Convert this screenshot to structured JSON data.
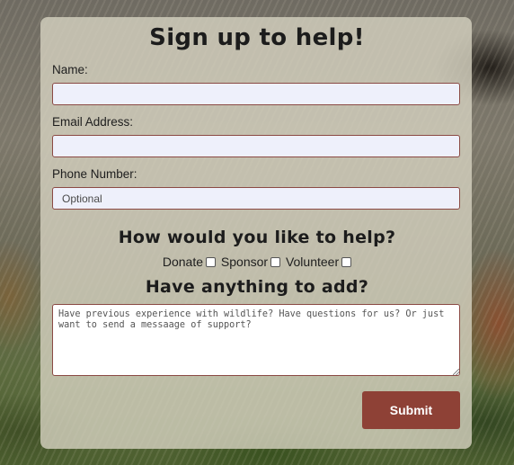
{
  "form": {
    "title": "Sign up to help!",
    "name_label": "Name:",
    "name_value": "",
    "email_label": "Email Address:",
    "email_value": "",
    "phone_label": "Phone Number:",
    "phone_value": "",
    "phone_placeholder": "Optional",
    "help_heading": "How would you like to help?",
    "options": [
      {
        "label": "Donate",
        "checked": false
      },
      {
        "label": "Sponsor",
        "checked": false
      },
      {
        "label": "Volunteer",
        "checked": false
      }
    ],
    "add_heading": "Have anything to add?",
    "message_value": "",
    "message_placeholder": "Have previous experience with wildlife? Have questions for us? Or just want to send a messaage of support?",
    "submit_label": "Submit"
  },
  "colors": {
    "panel": "#d6d2c0",
    "field_border": "#8b4a44",
    "field_bg": "#eef0fb",
    "submit_bg": "#8e4136",
    "text": "#1c1c1c"
  }
}
